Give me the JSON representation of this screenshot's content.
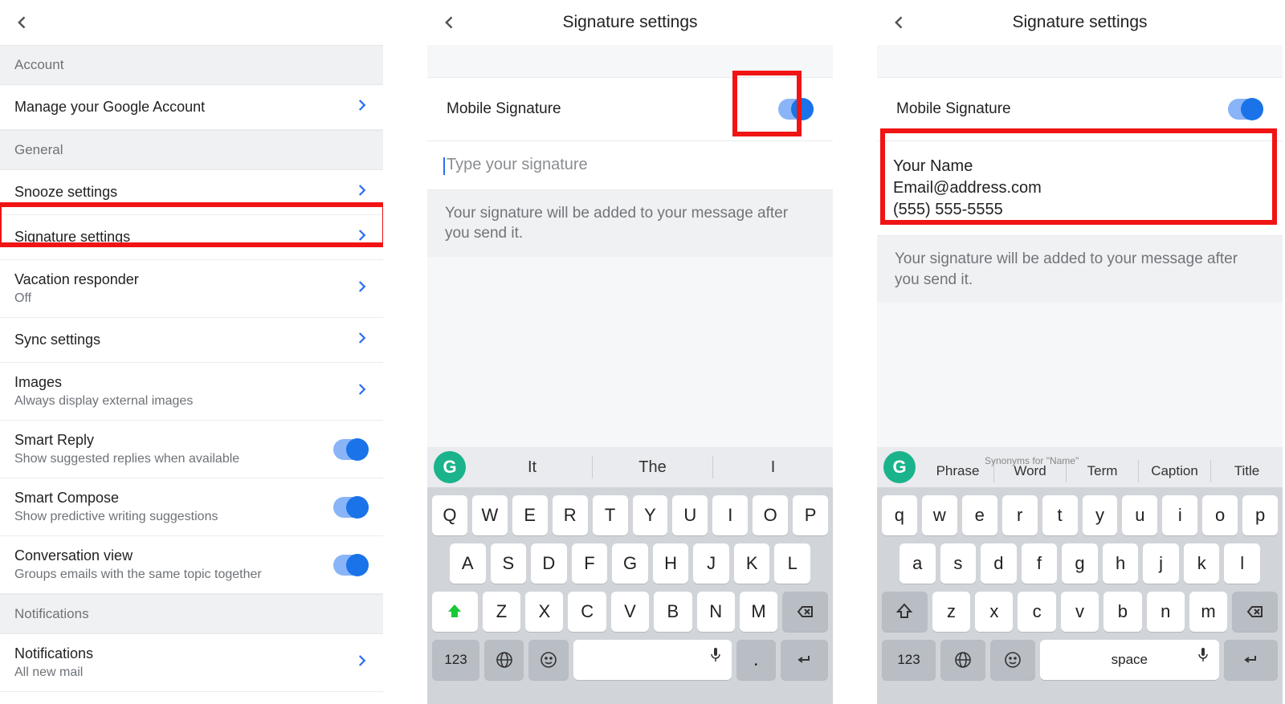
{
  "pane1": {
    "sections": {
      "account": "Account",
      "general": "General",
      "notifications": "Notifications"
    },
    "rows": {
      "manage": {
        "label": "Manage your Google Account"
      },
      "snooze": {
        "label": "Snooze settings"
      },
      "signature": {
        "label": "Signature settings"
      },
      "vacation": {
        "label": "Vacation responder",
        "sub": "Off"
      },
      "sync": {
        "label": "Sync settings"
      },
      "images": {
        "label": "Images",
        "sub": "Always display external images"
      },
      "smartreply": {
        "label": "Smart Reply",
        "sub": "Show suggested replies when available"
      },
      "smartcompose": {
        "label": "Smart Compose",
        "sub": "Show predictive writing suggestions"
      },
      "convview": {
        "label": "Conversation view",
        "sub": "Groups emails with the same topic together"
      },
      "notifs": {
        "label": "Notifications",
        "sub": "All new mail"
      }
    }
  },
  "pane2": {
    "title": "Signature settings",
    "toggle_label": "Mobile Signature",
    "placeholder": "Type your signature",
    "hint": "Your signature will be added to your message after you send it.",
    "suggestions": [
      "It",
      "The",
      "I"
    ],
    "key_rows": {
      "r1": [
        "Q",
        "W",
        "E",
        "R",
        "T",
        "Y",
        "U",
        "I",
        "O",
        "P"
      ],
      "r2": [
        "A",
        "S",
        "D",
        "F",
        "G",
        "H",
        "J",
        "K",
        "L"
      ],
      "r3": [
        "Z",
        "X",
        "C",
        "V",
        "B",
        "N",
        "M"
      ],
      "numkey": "123",
      "period": "."
    }
  },
  "pane3": {
    "title": "Signature settings",
    "toggle_label": "Mobile Signature",
    "signature_lines": {
      "l1": "Your Name",
      "l2": "Email@address.com",
      "l3": "(555) 555-5555"
    },
    "hint": "Your signature will be added to your message after you send it.",
    "sug_header": "Synonyms for \"Name\"",
    "suggestions": [
      "Phrase",
      "Word",
      "Term",
      "Caption",
      "Title"
    ],
    "key_rows": {
      "r1": [
        "q",
        "w",
        "e",
        "r",
        "t",
        "y",
        "u",
        "i",
        "o",
        "p"
      ],
      "r2": [
        "a",
        "s",
        "d",
        "f",
        "g",
        "h",
        "j",
        "k",
        "l"
      ],
      "r3": [
        "z",
        "x",
        "c",
        "v",
        "b",
        "n",
        "m"
      ],
      "numkey": "123",
      "space_label": "space"
    }
  }
}
